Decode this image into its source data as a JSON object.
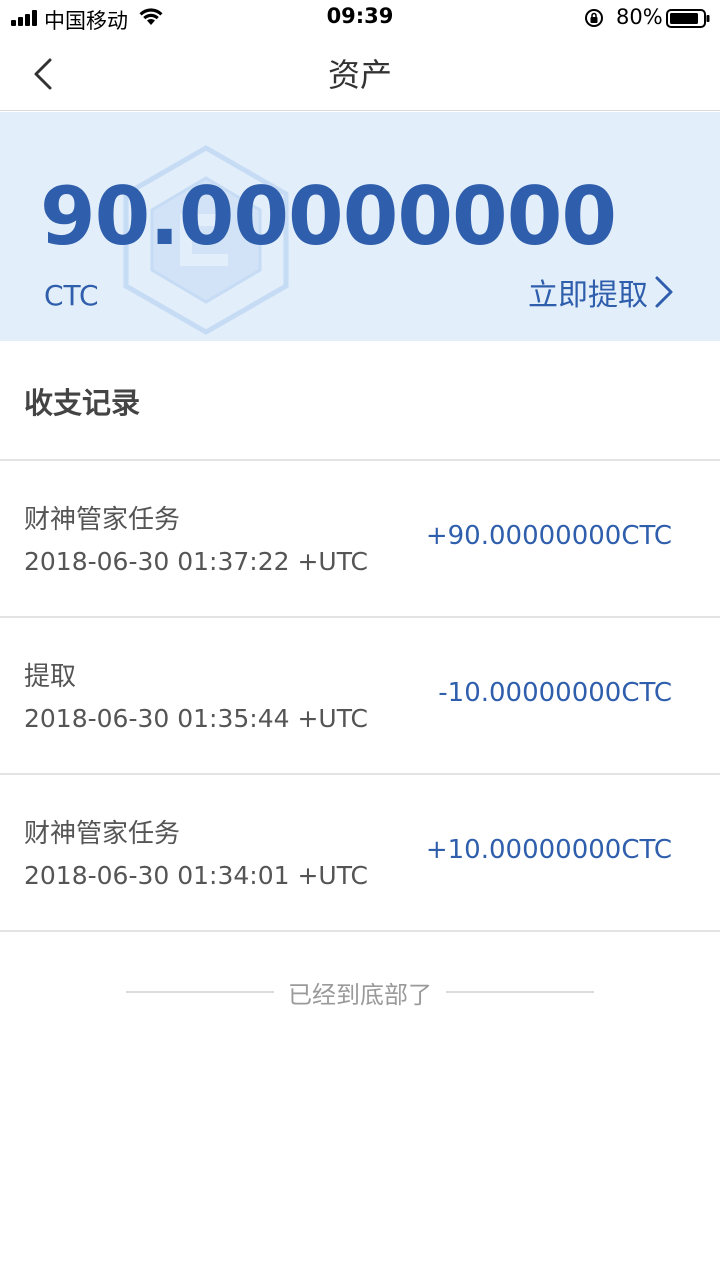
{
  "status_bar": {
    "carrier": "中国移动",
    "time": "09:39",
    "battery": "80%"
  },
  "nav": {
    "title": "资产",
    "back_icon": "chevron-left-icon"
  },
  "balance": {
    "amount": "90.00000000",
    "unit": "CTC",
    "withdraw_label": "立即提取"
  },
  "records_section": {
    "title": "收支记录",
    "items": [
      {
        "type": "财神管家任务",
        "time": "2018-06-30 01:37:22 +UTC",
        "amount": "+90.00000000CTC"
      },
      {
        "type": "提取",
        "time": "2018-06-30 01:35:44 +UTC",
        "amount": "-10.00000000CTC"
      },
      {
        "type": "财神管家任务",
        "time": "2018-06-30 01:34:01 +UTC",
        "amount": "+10.00000000CTC"
      }
    ],
    "end_text": "已经到底部了"
  },
  "colors": {
    "accent": "#2f5fac",
    "card_bg": "#e3eefb",
    "text": "#555555",
    "muted": "#9a9a9a"
  }
}
